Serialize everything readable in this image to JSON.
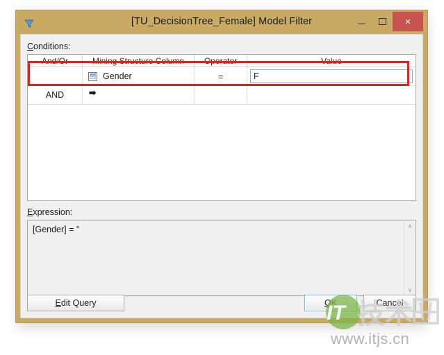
{
  "window": {
    "title": "[TU_DecisionTree_Female] Model Filter",
    "icon": "filter-funnel-icon",
    "frame_color": "#c9aa62",
    "client_color": "#f0f0f0",
    "caption_buttons": {
      "minimize_label": "–",
      "maximize_label": "□",
      "close_label": "×",
      "close_color": "#c9534f"
    }
  },
  "conditions": {
    "label_accel": "C",
    "label_rest": "onditions:",
    "columns": [
      {
        "key": "andor",
        "header": "And/Or"
      },
      {
        "key": "column",
        "header": "Mining Structure Column"
      },
      {
        "key": "operator",
        "header": "Operator"
      },
      {
        "key": "value",
        "header": "Value"
      }
    ],
    "rows": [
      {
        "andor": "",
        "column": "Gender",
        "column_icon": "table-column-icon",
        "operator": "=",
        "value": "F",
        "value_is_input": true,
        "row_marker": ""
      },
      {
        "andor": "AND",
        "column": "",
        "column_icon": "",
        "operator": "",
        "value": "",
        "value_is_input": false,
        "row_marker": "row-selector-arrow-icon"
      }
    ]
  },
  "expression": {
    "label_accel": "E",
    "label_rest": "xpression:",
    "text": "[Gender] = ''",
    "scrollbar": {
      "up_arrow": "∧",
      "down_arrow": "∨"
    }
  },
  "footer": {
    "edit_query": {
      "accel": "E",
      "rest": "dit Query"
    },
    "ok": {
      "accel": "O",
      "rest": "K"
    },
    "cancel": {
      "accel": "",
      "rest": "Cancel"
    }
  },
  "annotation": {
    "color": "#ee1d1d",
    "target": "gender-condition-row"
  },
  "watermark": {
    "logo_prefix": "IT",
    "logo_text": "技术网",
    "url": "www.itjs.cn"
  }
}
